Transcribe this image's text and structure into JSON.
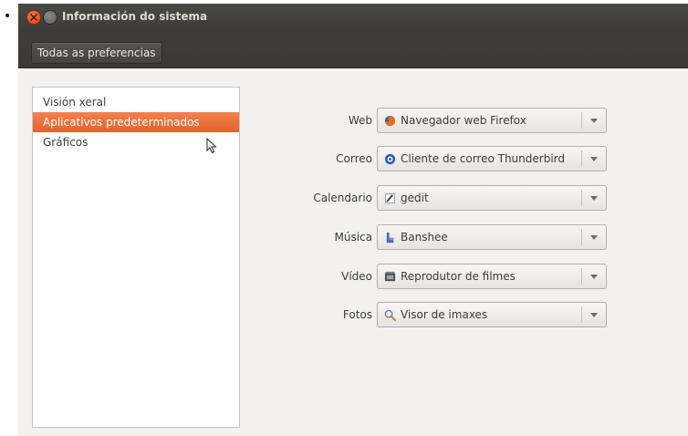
{
  "window": {
    "title": "Información do sistema"
  },
  "toolbar": {
    "all_settings_label": "Todas as preferencias"
  },
  "sidebar": {
    "items": [
      {
        "label": "Visión xeral",
        "selected": false
      },
      {
        "label": "Aplicativos predeterminados",
        "selected": true
      },
      {
        "label": "Gráficos",
        "selected": false
      }
    ]
  },
  "defaults": [
    {
      "label": "Web",
      "value": "Navegador web Firefox",
      "icon": "firefox-icon"
    },
    {
      "label": "Correo",
      "value": "Cliente de correo Thunderbird",
      "icon": "thunderbird-icon"
    },
    {
      "label": "Calendario",
      "value": "gedit",
      "icon": "gedit-icon"
    },
    {
      "label": "Música",
      "value": "Banshee",
      "icon": "banshee-icon"
    },
    {
      "label": "Vídeo",
      "value": "Reprodutor de filmes",
      "icon": "movie-player-icon"
    },
    {
      "label": "Fotos",
      "value": "Visor de imaxes",
      "icon": "image-viewer-icon"
    }
  ],
  "colors": {
    "selection": "#e96e34",
    "titlebar": "#3c3b37"
  }
}
